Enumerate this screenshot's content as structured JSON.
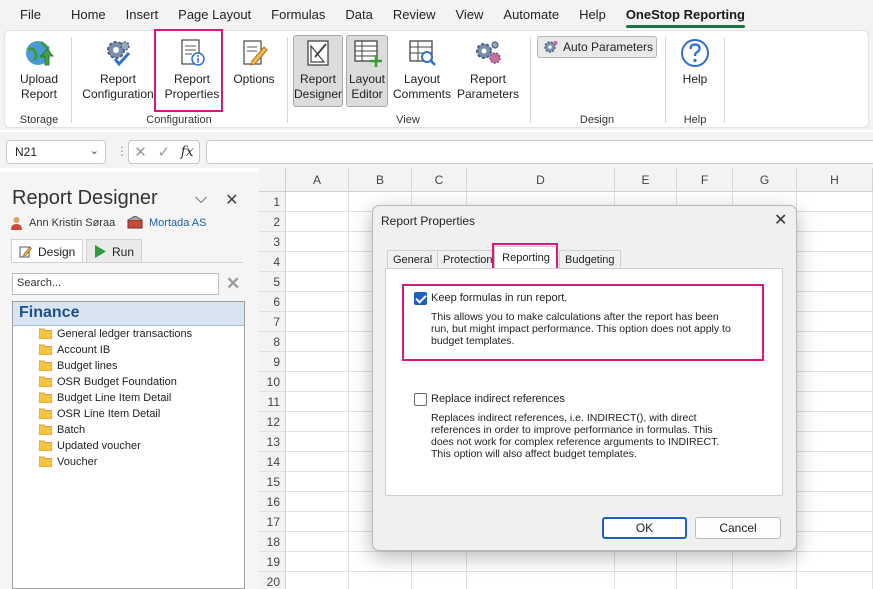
{
  "menu": [
    "File",
    "Home",
    "Insert",
    "Page Layout",
    "Formulas",
    "Data",
    "Review",
    "View",
    "Automate",
    "Help",
    "OneStop Reporting"
  ],
  "ribbon": {
    "upload": "Upload\nReport",
    "report_config": "Report\nConfiguration",
    "report_props": "Report\nProperties",
    "options": "Options",
    "report_designer": "Report\nDesigner",
    "layout_editor": "Layout\nEditor",
    "layout_comments": "Layout\nComments",
    "report_params": "Report\nParameters",
    "auto_params": "Auto Parameters",
    "help": "Help",
    "groups": {
      "storage": "Storage",
      "configuration": "Configuration",
      "view": "View",
      "design": "Design",
      "help": "Help"
    }
  },
  "formula_bar": {
    "name_box": "N21",
    "cancel": "✕",
    "enter": "✓",
    "fx": "fx"
  },
  "pane": {
    "title": "Report Designer",
    "user": "Ann Kristin Søraa",
    "company": "Mortada AS",
    "tab_design": "Design",
    "tab_run": "Run",
    "search_placeholder": "Search...",
    "tree_header": "Finance",
    "tree_items": [
      "General ledger transactions",
      "Account IB",
      "Budget lines",
      "OSR Budget Foundation",
      "Budget Line Item Detail",
      "OSR Line Item Detail",
      "Batch",
      "Updated voucher",
      "Voucher"
    ]
  },
  "sheet": {
    "columns": [
      "A",
      "B",
      "C",
      "D",
      "E",
      "F",
      "G",
      "H"
    ],
    "rows": [
      "1",
      "2",
      "3",
      "4",
      "5",
      "6",
      "7",
      "8",
      "9",
      "10",
      "11",
      "12",
      "13",
      "14",
      "15",
      "16",
      "17",
      "18",
      "19",
      "20"
    ]
  },
  "dialog": {
    "title": "Report Properties",
    "tabs": [
      "General",
      "Protection",
      "Reporting",
      "Budgeting"
    ],
    "opt1_label": "Keep formulas in run report.",
    "opt1_desc1": "This allows you to make calculations after the report has been",
    "opt1_desc2": "run, but might impact performance. This option does not apply to",
    "opt1_desc3": "budget templates.",
    "opt1_checked": true,
    "opt2_label": "Replace indirect references",
    "opt2_desc1": "Replaces indirect references, i.e. INDIRECT(), with direct",
    "opt2_desc2": "references in order to improve performance in formulas. This",
    "opt2_desc3": "does not work for complex reference arguments to INDIRECT.",
    "opt2_desc4": "This option will also affect budget templates.",
    "opt2_checked": false,
    "ok": "OK",
    "cancel": "Cancel"
  },
  "colors": {
    "highlight": "#d9177d",
    "accent": "#1f5fbf",
    "excel_green": "#1e7145"
  }
}
